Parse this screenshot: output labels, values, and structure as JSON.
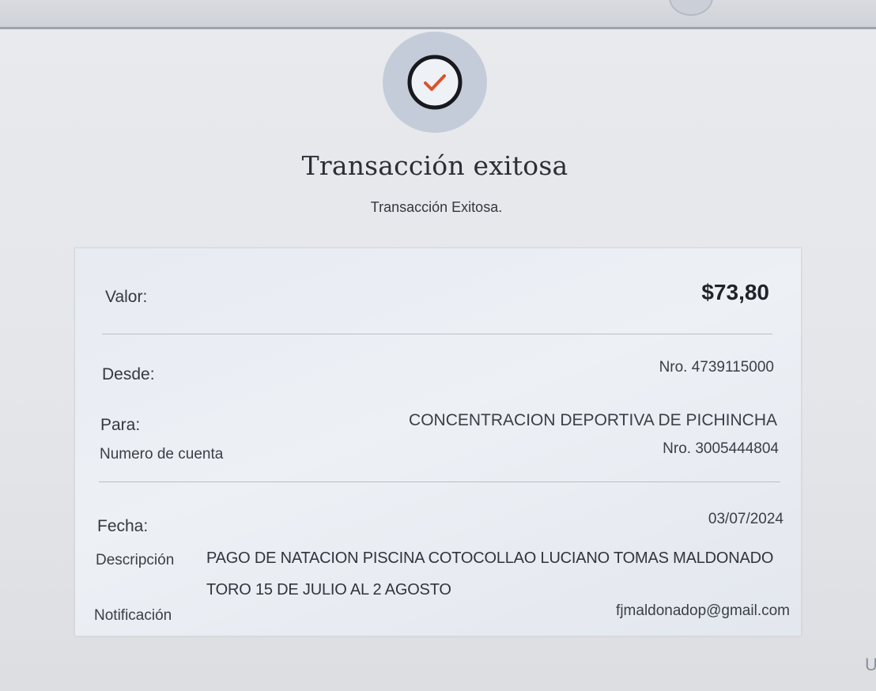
{
  "header": {
    "title": "Transacción exitosa",
    "subtitle": "Transacción Exitosa."
  },
  "icons": {
    "status": "check-circle-icon",
    "accent_color": "#d9532c"
  },
  "receipt": {
    "valor_label": "Valor:",
    "valor_value": "$73,80",
    "desde_label": "Desde:",
    "desde_value": "Nro. 4739115000",
    "para_label": "Para:",
    "para_value": "CONCENTRACION DEPORTIVA DE PICHINCHA",
    "cuenta_label": "Numero de cuenta",
    "cuenta_value": "Nro. 3005444804",
    "fecha_label": "Fecha:",
    "fecha_value": "03/07/2024",
    "descripcion_label": "Descripción",
    "descripcion_value": "PAGO DE NATACION PISCINA COTOCOLLAO LUCIANO TOMAS MALDONADO TORO 15 DE JULIO AL 2 AGOSTO",
    "notificacion_label": "Notificación",
    "notificacion_value": "fjmaldonadop@gmail.com"
  },
  "edge_text": "U"
}
